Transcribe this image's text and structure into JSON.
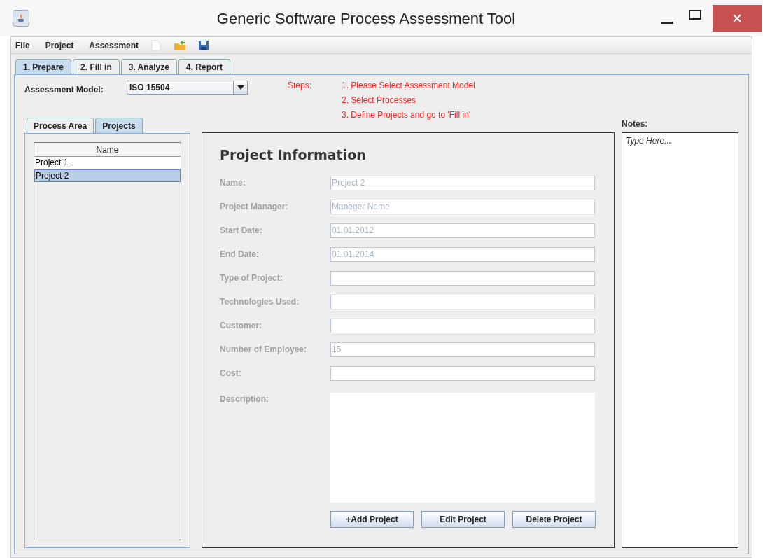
{
  "window": {
    "title": "Generic Software Process Assessment Tool"
  },
  "menu": [
    "File",
    "Project",
    "Assessment"
  ],
  "tabs": [
    {
      "label": "1. Prepare",
      "selected": true
    },
    {
      "label": "2. Fill in",
      "selected": false
    },
    {
      "label": "3. Analyze",
      "selected": false
    },
    {
      "label": "4. Report",
      "selected": false
    }
  ],
  "assessment_model": {
    "label": "Assessment Model:",
    "value": "ISO 15504"
  },
  "steps": {
    "label": "Steps:",
    "items": [
      "1. Please Select Assessment Model",
      "2. Select Processes",
      "3. Define Projects and go to 'Fill in'"
    ]
  },
  "subtabs": [
    {
      "label": "Process Area",
      "selected": false
    },
    {
      "label": "Projects",
      "selected": true
    }
  ],
  "projects_table": {
    "column": "Name",
    "rows": [
      {
        "name": "Project 1",
        "selected": false
      },
      {
        "name": "Project 2",
        "selected": true
      }
    ]
  },
  "project_info": {
    "title": "Project Information",
    "disabled": true,
    "fields": [
      {
        "label": "Name:",
        "value": "Project 2"
      },
      {
        "label": "Project Manager:",
        "value": "Maneger Name"
      },
      {
        "label": "Start Date:",
        "value": "01.01.2012"
      },
      {
        "label": "End Date:",
        "value": "01.01.2014"
      },
      {
        "label": "Type of Project:"
      },
      {
        "label": "Technologies Used:"
      },
      {
        "label": "Customer:"
      },
      {
        "label": "Number of Employee:",
        "value": "15"
      },
      {
        "label": "Cost:"
      }
    ],
    "description": {
      "label": "Description:"
    },
    "buttons": [
      "+Add Project",
      "Edit Project",
      "Delete Project"
    ]
  },
  "notes": {
    "label": "Notes:",
    "placeholder": "Type Here..."
  }
}
